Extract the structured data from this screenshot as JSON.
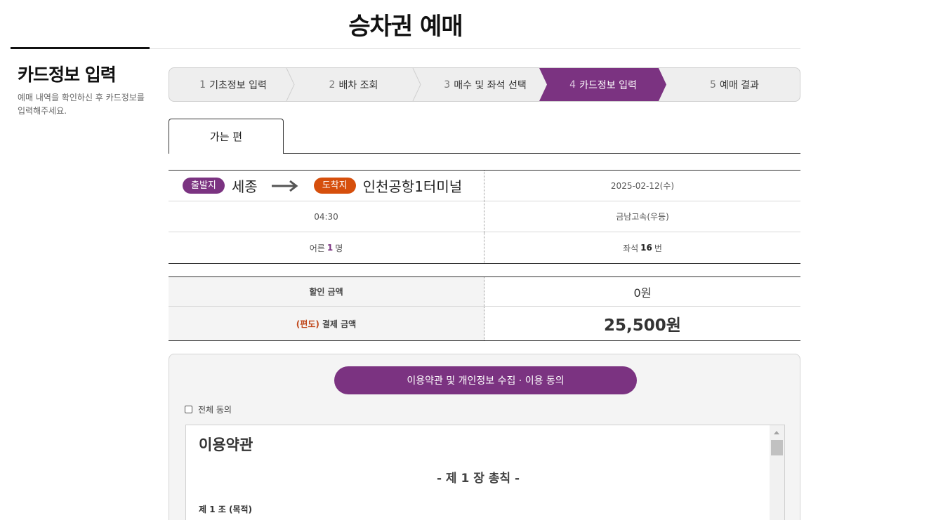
{
  "page": {
    "title": "승차권 예매"
  },
  "sidebar": {
    "title": "카드정보 입력",
    "description": "예매 내역을 확인하신 후 카드정보를 입력해주세요."
  },
  "steps": [
    {
      "num": "1",
      "label": "기초정보 입력",
      "active": false
    },
    {
      "num": "2",
      "label": "배차 조회",
      "active": false
    },
    {
      "num": "3",
      "label": "매수 및 좌석 선택",
      "active": false
    },
    {
      "num": "4",
      "label": "카드정보 입력",
      "active": true
    },
    {
      "num": "5",
      "label": "예매 결과",
      "active": false
    }
  ],
  "tab": {
    "label": "가는 편"
  },
  "trip": {
    "departure_badge": "출발지",
    "departure": "세종",
    "arrival_badge": "도착지",
    "arrival": "인천공항1터미널",
    "date": "2025-02-12(수)",
    "time": "04:30",
    "bus_company": "금남고속(우등)",
    "passenger_prefix": "어른",
    "passenger_count": "1",
    "passenger_unit": "명",
    "seat_prefix": "좌석",
    "seat_number": "16",
    "seat_unit": "번"
  },
  "payment": {
    "discount_label": "할인 금액",
    "discount_value": "0원",
    "oneway_tag": "(편도)",
    "total_label": "결제 금액",
    "total_value": "25,500원"
  },
  "agreement": {
    "button_label": "이용약관 및 개인정보 수집 · 이용 동의",
    "all_agree_label": "전체 동의",
    "all_agree_checked": false,
    "terms_title": "이용약관",
    "terms_chapter": "- 제 1 장 총칙 -",
    "terms_article": "제 1 조 (목적)"
  },
  "colors": {
    "accent": "#7b3381",
    "arrival_badge": "#d64f0c",
    "oneway_tag": "#c0481b"
  }
}
